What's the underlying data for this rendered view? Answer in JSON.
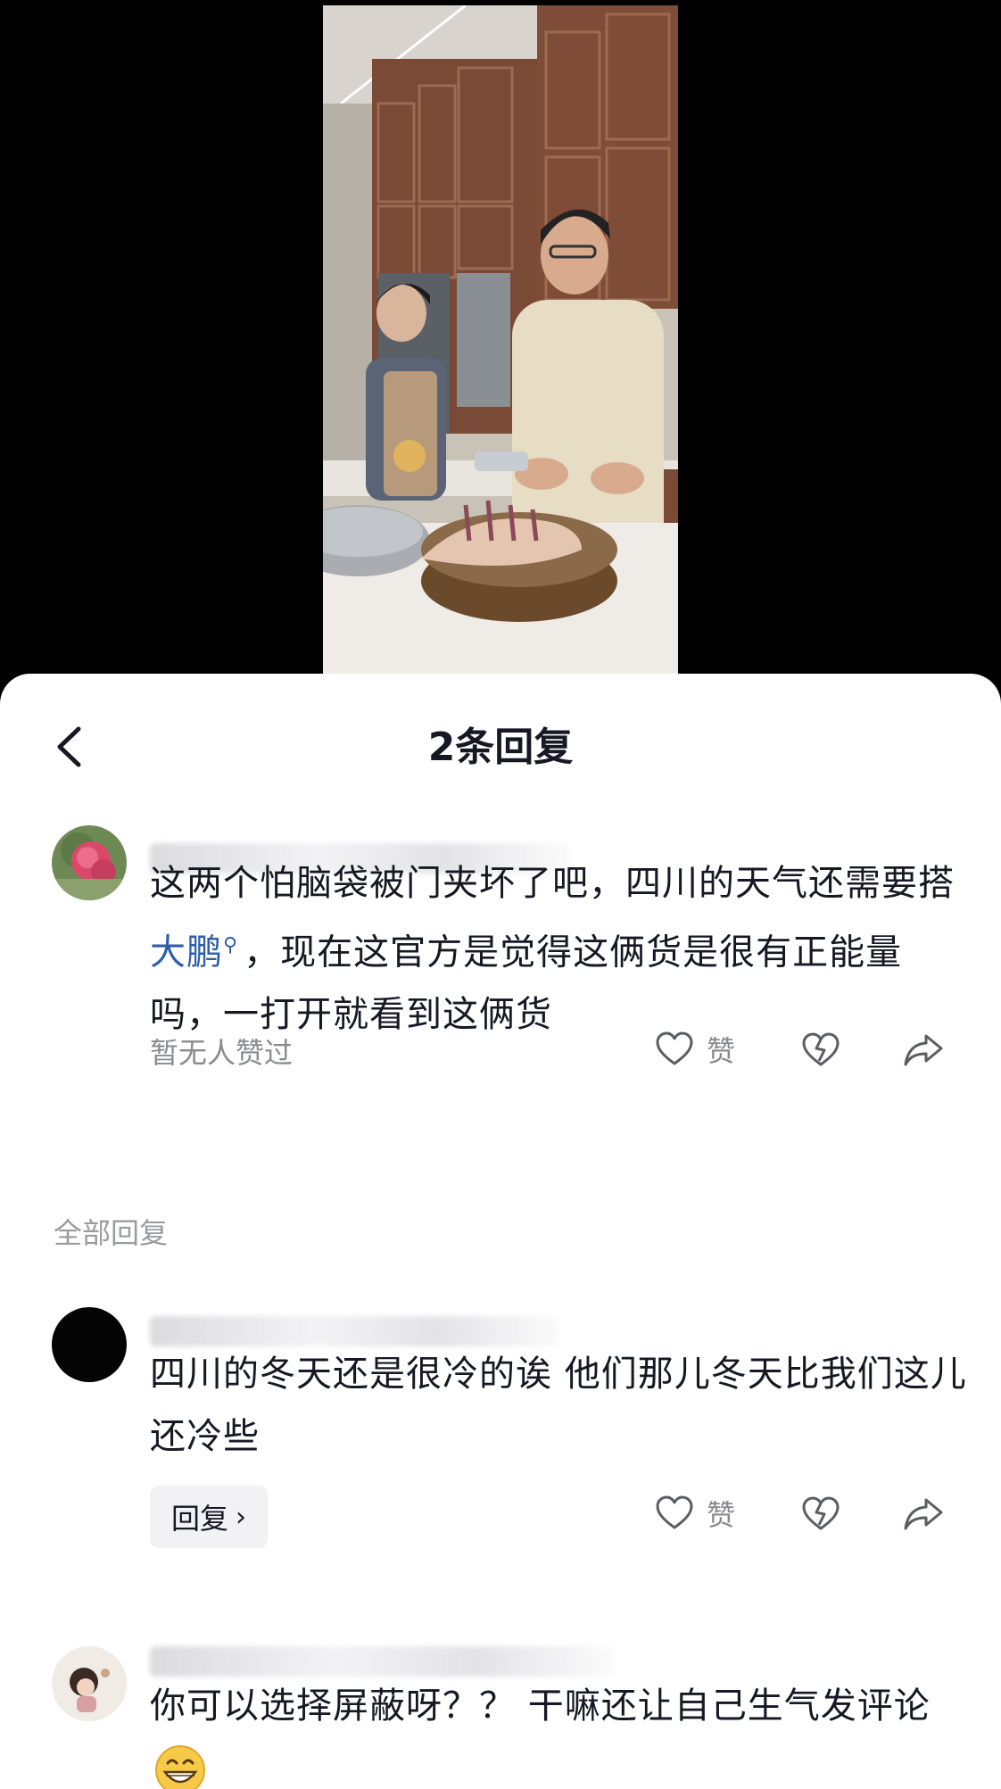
{
  "header": {
    "title": "2条回复"
  },
  "main_comment": {
    "text_before_mention": "这两个怕脑袋被门夹坏了吧，四川的天气还需要搭",
    "mention": "大鹏",
    "text_after_mention": "，现在这官方是觉得这俩货是很有正能量吗，一打开就看到这俩货",
    "likes_status": "暂无人赞过",
    "like_label": "赞"
  },
  "section_label": "全部回复",
  "replies": [
    {
      "text": "四川的冬天还是很冷的诶 他们那儿冬天比我们这儿还冷些",
      "reply_label": "回复",
      "like_label": "赞"
    },
    {
      "text": "你可以选择屏蔽呀？？ 干嘛还让自己生气发评论"
    }
  ],
  "icons": [
    "back-chevron-icon",
    "search-icon",
    "heart-icon",
    "broken-heart-icon",
    "share-arrow-icon",
    "grin-emoji-icon"
  ],
  "colors": {
    "mention": "#2f5da8",
    "muted": "#8a8b91",
    "chip_bg": "#f2f2f4"
  }
}
